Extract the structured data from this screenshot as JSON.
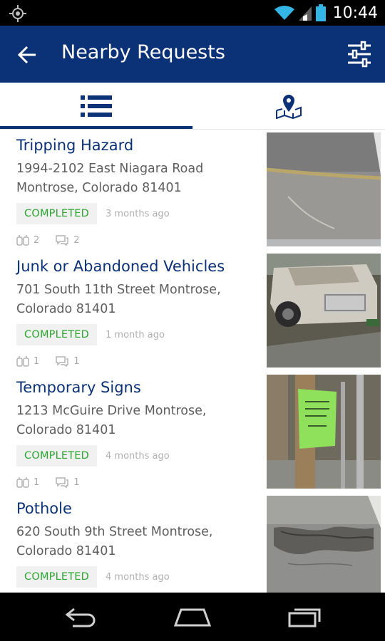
{
  "status_bar": {
    "time": "10:44"
  },
  "app_bar": {
    "title": "Nearby Requests",
    "back_icon": "arrow-left-icon",
    "filter_icon": "sliders-icon",
    "background": "#0b3277"
  },
  "tabs": [
    {
      "name": "list",
      "icon": "list-icon",
      "selected": true
    },
    {
      "name": "map",
      "icon": "map-pin-icon",
      "selected": false
    }
  ],
  "requests": [
    {
      "title": "Tripping Hazard",
      "address": "1994-2102  East Niagara Road\nMontrose, Colorado 81401",
      "status": "COMPLETED",
      "time_ago": "3 months ago",
      "followers": "2",
      "comments": "2",
      "photo": "cracked-pavement"
    },
    {
      "title": "Junk or Abandoned Vehicles",
      "address": "701  South 11th Street Montrose,\nColorado 81401",
      "status": "COMPLETED",
      "time_ago": "1 month ago",
      "followers": "1",
      "comments": "1",
      "photo": "old-car"
    },
    {
      "title": "Temporary Signs",
      "address": "1213  McGuire Drive Montrose,\nColorado 81401",
      "status": "COMPLETED",
      "time_ago": "4 months ago",
      "followers": "1",
      "comments": "1",
      "photo": "sign-on-pole"
    },
    {
      "title": "Pothole",
      "address": "620  South 9th Street Montrose,\nColorado 81401",
      "status": "COMPLETED",
      "time_ago": "4 months ago",
      "photo": "pothole"
    }
  ],
  "colors": {
    "status_completed": "#2aa52f",
    "title_text": "#0b3277"
  }
}
